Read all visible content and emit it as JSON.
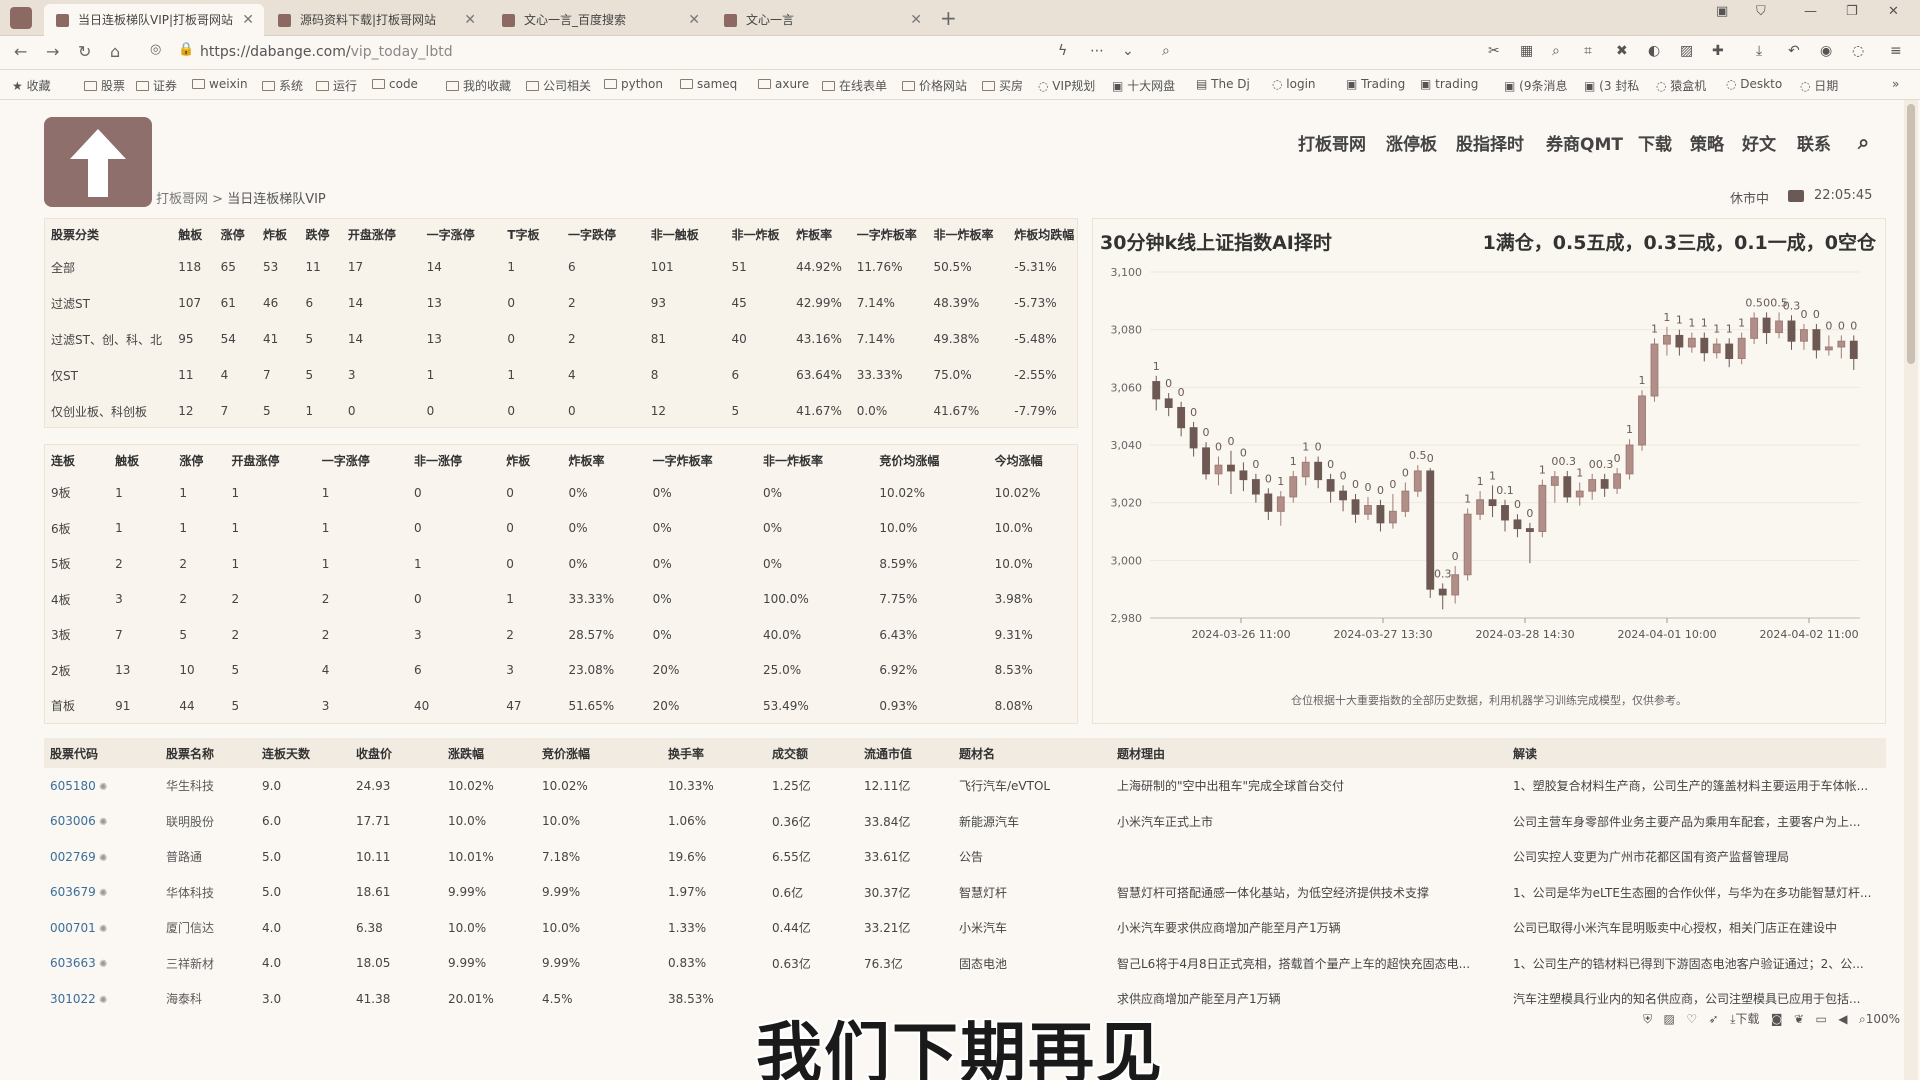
{
  "browser": {
    "tabs": [
      {
        "label": "当日连板梯队VIP|打板哥网站"
      },
      {
        "label": "源码资料下载|打板哥网站"
      },
      {
        "label": "文心一言_百度搜索"
      },
      {
        "label": "文心一言"
      }
    ],
    "url_host": "https://dabange.com/",
    "url_path": "vip_today_lbtd",
    "bookmarks": [
      "收藏",
      "股票",
      "证券",
      "weixin",
      "系统",
      "运行",
      "code",
      "我的收藏",
      "公司相关",
      "python",
      "sameq",
      "axure",
      "在线表单",
      "价格网站",
      "买房",
      "VIP规划",
      "十大网盘",
      "The Dj",
      "login",
      "Trading",
      "trading",
      "(9条消息",
      "(3 封私",
      "猿盒机",
      "Deskto",
      "日期"
    ]
  },
  "site": {
    "nav": [
      "打板哥网",
      "涨停板",
      "股指择时",
      "券商QMT",
      "下载",
      "策略",
      "好文",
      "联系"
    ],
    "breadcrumb_home": "打板哥网",
    "breadcrumb_sep": " > ",
    "breadcrumb_current": "当日连板梯队VIP",
    "market_status": "休市中",
    "clock": "22:05:45"
  },
  "summary_table": {
    "headers": [
      "股票分类",
      "触板",
      "涨停",
      "炸板",
      "跌停",
      "开盘涨停",
      "一字涨停",
      "T字板",
      "一字跌停",
      "非一触板",
      "非一炸板",
      "炸板率",
      "一字炸板率",
      "非一炸板率",
      "炸板均跌幅"
    ],
    "rows": [
      [
        "全部",
        "118",
        "65",
        "53",
        "11",
        "17",
        "14",
        "1",
        "6",
        "101",
        "51",
        "44.92%",
        "11.76%",
        "50.5%",
        "-5.31%"
      ],
      [
        "过滤ST",
        "107",
        "61",
        "46",
        "6",
        "14",
        "13",
        "0",
        "2",
        "93",
        "45",
        "42.99%",
        "7.14%",
        "48.39%",
        "-5.73%"
      ],
      [
        "过滤ST、创、科、北",
        "95",
        "54",
        "41",
        "5",
        "14",
        "13",
        "0",
        "2",
        "81",
        "40",
        "43.16%",
        "7.14%",
        "49.38%",
        "-5.48%"
      ],
      [
        "仅ST",
        "11",
        "4",
        "7",
        "5",
        "3",
        "1",
        "1",
        "4",
        "8",
        "6",
        "63.64%",
        "33.33%",
        "75.0%",
        "-2.55%"
      ],
      [
        "仅创业板、科创板",
        "12",
        "7",
        "5",
        "1",
        "0",
        "0",
        "0",
        "0",
        "12",
        "5",
        "41.67%",
        "0.0%",
        "41.67%",
        "-7.79%"
      ]
    ]
  },
  "ladder_table": {
    "headers": [
      "连板",
      "触板",
      "涨停",
      "开盘涨停",
      "一字涨停",
      "非一涨停",
      "炸板",
      "炸板率",
      "一字炸板率",
      "非一炸板率",
      "竞价均涨幅",
      "今均涨幅"
    ],
    "rows": [
      [
        "9板",
        "1",
        "1",
        "1",
        "1",
        "0",
        "0",
        "0%",
        "0%",
        "0%",
        "10.02%",
        "10.02%"
      ],
      [
        "6板",
        "1",
        "1",
        "1",
        "1",
        "0",
        "0",
        "0%",
        "0%",
        "0%",
        "10.0%",
        "10.0%"
      ],
      [
        "5板",
        "2",
        "2",
        "1",
        "1",
        "1",
        "0",
        "0%",
        "0%",
        "0%",
        "8.59%",
        "10.0%"
      ],
      [
        "4板",
        "3",
        "2",
        "2",
        "2",
        "0",
        "1",
        "33.33%",
        "0%",
        "100.0%",
        "7.75%",
        "3.98%"
      ],
      [
        "3板",
        "7",
        "5",
        "2",
        "2",
        "3",
        "2",
        "28.57%",
        "0%",
        "40.0%",
        "6.43%",
        "9.31%"
      ],
      [
        "2板",
        "13",
        "10",
        "5",
        "4",
        "6",
        "3",
        "23.08%",
        "20%",
        "25.0%",
        "6.92%",
        "8.53%"
      ],
      [
        "首板",
        "91",
        "44",
        "5",
        "3",
        "40",
        "47",
        "51.65%",
        "20%",
        "53.49%",
        "0.93%",
        "8.08%"
      ]
    ]
  },
  "stock_table": {
    "headers": [
      "股票代码",
      "股票名称",
      "连板天数",
      "收盘价",
      "涨跌幅",
      "竞价涨幅",
      "换手率",
      "成交额",
      "流通市值",
      "题材名",
      "题材理由",
      "解读"
    ],
    "rows": [
      [
        "605180",
        "华生科技",
        "9.0",
        "24.93",
        "10.02%",
        "10.02%",
        "10.33%",
        "1.25亿",
        "12.11亿",
        "飞行汽车/eVTOL",
        "上海研制的\"空中出租车\"完成全球首台交付",
        "1、塑胶复合材料生产商，公司生产的篷盖材料主要运用于车体帐..."
      ],
      [
        "603006",
        "联明股份",
        "6.0",
        "17.71",
        "10.0%",
        "10.0%",
        "1.06%",
        "0.36亿",
        "33.84亿",
        "新能源汽车",
        "小米汽车正式上市",
        "公司主营车身零部件业务主要产品为乘用车配套，主要客户为上..."
      ],
      [
        "002769",
        "普路通",
        "5.0",
        "10.11",
        "10.01%",
        "7.18%",
        "19.6%",
        "6.55亿",
        "33.61亿",
        "公告",
        "",
        "公司实控人变更为广州市花都区国有资产监督管理局"
      ],
      [
        "603679",
        "华体科技",
        "5.0",
        "18.61",
        "9.99%",
        "9.99%",
        "1.97%",
        "0.6亿",
        "30.37亿",
        "智慧灯杆",
        "智慧灯杆可搭配通感一体化基站，为低空经济提供技术支撑",
        "1、公司是华为eLTE生态圈的合作伙伴，与华为在多功能智慧灯杆..."
      ],
      [
        "000701",
        "厦门信达",
        "4.0",
        "6.38",
        "10.0%",
        "10.0%",
        "1.33%",
        "0.44亿",
        "33.21亿",
        "小米汽车",
        "小米汽车要求供应商增加产能至月产1万辆",
        "公司已取得小米汽车昆明贩卖中心授权，相关门店正在建设中"
      ],
      [
        "603663",
        "三祥新材",
        "4.0",
        "18.05",
        "9.99%",
        "9.99%",
        "0.83%",
        "0.63亿",
        "76.3亿",
        "固态电池",
        "智己L6将于4月8日正式亮相，搭载首个量产上车的超快充固态电...",
        "1、公司生产的锆材料已得到下游固态电池客户验证通过；2、公..."
      ],
      [
        "301022",
        "海泰科",
        "3.0",
        "41.38",
        "20.01%",
        "4.5%",
        "38.53%",
        "",
        "",
        "",
        "求供应商增加产能至月产1万辆",
        "汽车注塑模具行业内的知名供应商，公司注塑模具已应用于包括..."
      ]
    ]
  },
  "chart": {
    "title": "30分钟k线上证指数AI择时",
    "rule": "1满仓，0.5五成，0.3三成，0.1一成，0空仓",
    "note": "仓位根据十大重要指数的全部历史数据，利用机器学习训练完成模型，仅供参考。"
  },
  "chart_data": {
    "type": "candlestick",
    "y_ticks": [
      "3,100",
      "3,080",
      "3,060",
      "3,040",
      "3,020",
      "3,000",
      "2,980"
    ],
    "ylim": [
      2980,
      3100
    ],
    "x_ticks": [
      "2024-03-26 11:00",
      "2024-03-27 13:30",
      "2024-03-28 14:30",
      "2024-04-01 10:00",
      "2024-04-02 11:00"
    ],
    "candles": [
      {
        "o": 3062,
        "c": 3056,
        "h": 3064,
        "l": 3052,
        "label": "1"
      },
      {
        "o": 3056,
        "c": 3053,
        "h": 3058,
        "l": 3050,
        "label": "0"
      },
      {
        "o": 3053,
        "c": 3046,
        "h": 3055,
        "l": 3043,
        "label": "0"
      },
      {
        "o": 3046,
        "c": 3039,
        "h": 3048,
        "l": 3036,
        "label": "0"
      },
      {
        "o": 3039,
        "c": 3030,
        "h": 3041,
        "l": 3028,
        "label": "0"
      },
      {
        "o": 3030,
        "c": 3033,
        "h": 3036,
        "l": 3026,
        "label": "0"
      },
      {
        "o": 3033,
        "c": 3031,
        "h": 3038,
        "l": 3023,
        "label": "0"
      },
      {
        "o": 3031,
        "c": 3028,
        "h": 3034,
        "l": 3024,
        "label": "0"
      },
      {
        "o": 3028,
        "c": 3023,
        "h": 3030,
        "l": 3020,
        "label": "0"
      },
      {
        "o": 3023,
        "c": 3017,
        "h": 3025,
        "l": 3014,
        "label": "0"
      },
      {
        "o": 3017,
        "c": 3022,
        "h": 3024,
        "l": 3012,
        "label": "1"
      },
      {
        "o": 3022,
        "c": 3029,
        "h": 3031,
        "l": 3020,
        "label": "1"
      },
      {
        "o": 3029,
        "c": 3034,
        "h": 3036,
        "l": 3026,
        "label": "1"
      },
      {
        "o": 3034,
        "c": 3028,
        "h": 3036,
        "l": 3025,
        "label": "0"
      },
      {
        "o": 3028,
        "c": 3024,
        "h": 3030,
        "l": 3020,
        "label": "0"
      },
      {
        "o": 3024,
        "c": 3021,
        "h": 3026,
        "l": 3017,
        "label": "0"
      },
      {
        "o": 3021,
        "c": 3016,
        "h": 3023,
        "l": 3013,
        "label": "0"
      },
      {
        "o": 3016,
        "c": 3019,
        "h": 3022,
        "l": 3014,
        "label": "0"
      },
      {
        "o": 3019,
        "c": 3013,
        "h": 3021,
        "l": 3010,
        "label": "0"
      },
      {
        "o": 3013,
        "c": 3017,
        "h": 3023,
        "l": 3011,
        "label": "0"
      },
      {
        "o": 3017,
        "c": 3024,
        "h": 3027,
        "l": 3015,
        "label": "0"
      },
      {
        "o": 3024,
        "c": 3031,
        "h": 3033,
        "l": 3022,
        "label": "0.5"
      },
      {
        "o": 3031,
        "c": 2990,
        "h": 3032,
        "l": 2987,
        "label": "0"
      },
      {
        "o": 2990,
        "c": 2988,
        "h": 2992,
        "l": 2983,
        "label": "0.3"
      },
      {
        "o": 2988,
        "c": 2995,
        "h": 2998,
        "l": 2985,
        "label": "0"
      },
      {
        "o": 2995,
        "c": 3016,
        "h": 3018,
        "l": 2993,
        "label": "1"
      },
      {
        "o": 3016,
        "c": 3021,
        "h": 3024,
        "l": 3014,
        "label": "1"
      },
      {
        "o": 3021,
        "c": 3019,
        "h": 3026,
        "l": 3015,
        "label": "1"
      },
      {
        "o": 3019,
        "c": 3014,
        "h": 3021,
        "l": 3010,
        "label": "0.1"
      },
      {
        "o": 3014,
        "c": 3011,
        "h": 3016,
        "l": 3008,
        "label": "0"
      },
      {
        "o": 3011,
        "c": 3010,
        "h": 3013,
        "l": 2999,
        "label": "0"
      },
      {
        "o": 3010,
        "c": 3026,
        "h": 3028,
        "l": 3008,
        "label": "1"
      },
      {
        "o": 3026,
        "c": 3029,
        "h": 3031,
        "l": 3020,
        "label": "0"
      },
      {
        "o": 3029,
        "c": 3022,
        "h": 3031,
        "l": 3020,
        "label": "0.3"
      },
      {
        "o": 3022,
        "c": 3024,
        "h": 3027,
        "l": 3019,
        "label": "1"
      },
      {
        "o": 3024,
        "c": 3028,
        "h": 3030,
        "l": 3021,
        "label": "0"
      },
      {
        "o": 3028,
        "c": 3025,
        "h": 3030,
        "l": 3022,
        "label": "0.3"
      },
      {
        "o": 3025,
        "c": 3030,
        "h": 3032,
        "l": 3023,
        "label": "0"
      },
      {
        "o": 3030,
        "c": 3040,
        "h": 3042,
        "l": 3028,
        "label": "1"
      },
      {
        "o": 3040,
        "c": 3057,
        "h": 3059,
        "l": 3038,
        "label": "1"
      },
      {
        "o": 3057,
        "c": 3075,
        "h": 3077,
        "l": 3055,
        "label": "1"
      },
      {
        "o": 3075,
        "c": 3078,
        "h": 3081,
        "l": 3071,
        "label": "1"
      },
      {
        "o": 3078,
        "c": 3074,
        "h": 3080,
        "l": 3071,
        "label": "1"
      },
      {
        "o": 3074,
        "c": 3077,
        "h": 3079,
        "l": 3072,
        "label": "1"
      },
      {
        "o": 3077,
        "c": 3072,
        "h": 3079,
        "l": 3069,
        "label": "1"
      },
      {
        "o": 3072,
        "c": 3075,
        "h": 3077,
        "l": 3070,
        "label": "1"
      },
      {
        "o": 3075,
        "c": 3070,
        "h": 3077,
        "l": 3067,
        "label": "1"
      },
      {
        "o": 3070,
        "c": 3077,
        "h": 3079,
        "l": 3068,
        "label": "1"
      },
      {
        "o": 3077,
        "c": 3084,
        "h": 3086,
        "l": 3075,
        "label": "0.5"
      },
      {
        "o": 3084,
        "c": 3079,
        "h": 3086,
        "l": 3075,
        "label": "0"
      },
      {
        "o": 3079,
        "c": 3083,
        "h": 3086,
        "l": 3077,
        "label": "0.5"
      },
      {
        "o": 3083,
        "c": 3076,
        "h": 3085,
        "l": 3073,
        "label": "0.3"
      },
      {
        "o": 3076,
        "c": 3080,
        "h": 3082,
        "l": 3073,
        "label": "0"
      },
      {
        "o": 3080,
        "c": 3073,
        "h": 3082,
        "l": 3070,
        "label": "0"
      },
      {
        "o": 3073,
        "c": 3074,
        "h": 3078,
        "l": 3071,
        "label": "0"
      },
      {
        "o": 3074,
        "c": 3076,
        "h": 3078,
        "l": 3070,
        "label": "0"
      },
      {
        "o": 3076,
        "c": 3070,
        "h": 3078,
        "l": 3066,
        "label": "0"
      }
    ]
  },
  "subtitle": "我们下期再见",
  "statusbar": {
    "download_label": "下载",
    "zoom": "100%"
  }
}
